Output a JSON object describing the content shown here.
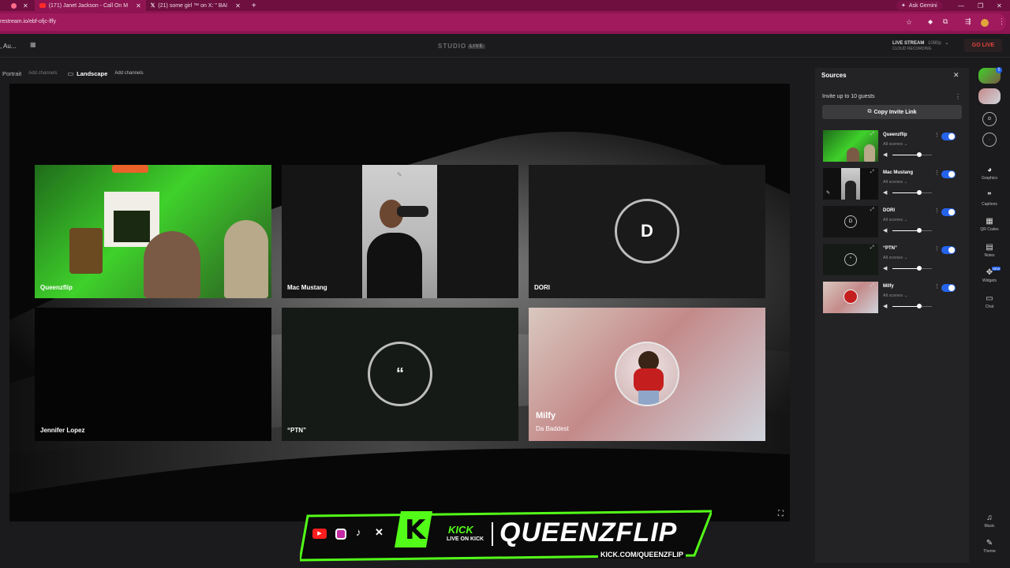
{
  "browser": {
    "tabs": [
      {
        "title": "(171) Janet Jackson - Call On M",
        "icon": "youtube-icon",
        "active": true
      },
      {
        "title": "(21) some girl ™ on X: \" BAI",
        "icon": "x-icon",
        "active": false
      }
    ],
    "new_tab": "+",
    "ask_gemini": "Ask Gemini",
    "url": "restream.io/ebf-ofjc-lffy"
  },
  "app": {
    "event_title": ", Au...",
    "studio_label": "STUDIO",
    "studio_badge": "LIVE",
    "live_stream_label": "LIVE STREAM",
    "live_stream_quality": "1080p",
    "cloud_recording": "CLOUD RECORDING",
    "go_live": "GO LIVE",
    "layout_tabs": [
      {
        "label": "Portrait",
        "add": "Add channels"
      },
      {
        "label": "Landscape",
        "add": "Add channels"
      }
    ]
  },
  "stage": {
    "tiles": [
      {
        "name": "Queenzflip",
        "kind": "video-green"
      },
      {
        "name": "Mac Mustang",
        "kind": "video-portrait"
      },
      {
        "name": "DORI",
        "kind": "avatar",
        "initial": "D"
      },
      {
        "name": "Jennifer Lopez",
        "kind": "blank"
      },
      {
        "name": "“PTN”",
        "kind": "avatar",
        "initial": "“"
      },
      {
        "name": "Milfy",
        "subtitle": "Da Baddest",
        "kind": "avatar-photo"
      }
    ]
  },
  "sources": {
    "title": "Sources",
    "invite_text": "Invite up to 10 guests",
    "copy_invite": "Copy Invite Link",
    "items": [
      {
        "name": "Queenzflip",
        "scenes": "All scenes",
        "volume": 0.75,
        "enabled": true
      },
      {
        "name": "Mac Mustang",
        "scenes": "All scenes",
        "volume": 0.75,
        "enabled": true
      },
      {
        "name": "DORI",
        "scenes": "All scenes",
        "volume": 0.75,
        "enabled": true
      },
      {
        "name": "“PTN”",
        "scenes": "All scenes",
        "volume": 0.75,
        "enabled": true
      },
      {
        "name": "Milfy",
        "scenes": "All scenes",
        "volume": 0.75,
        "enabled": true
      }
    ]
  },
  "rail": {
    "avatar_badge": "5",
    "items": [
      {
        "label": "Graphics",
        "icon": "palette-icon"
      },
      {
        "label": "Captions",
        "icon": "quote-icon"
      },
      {
        "label": "QR Codes",
        "icon": "qr-icon"
      },
      {
        "label": "Notes",
        "icon": "notes-icon"
      },
      {
        "label": "Widgets",
        "icon": "widgets-icon",
        "badge": "NEW"
      },
      {
        "label": "Chat",
        "icon": "chat-icon"
      },
      {
        "label": "Music",
        "icon": "music-icon"
      },
      {
        "label": "Theme",
        "icon": "theme-icon"
      }
    ]
  },
  "overlay": {
    "kick_word": "KICK",
    "kick_sub": "LIVE ON KICK",
    "brand": "QUEENZFLIP",
    "url": "KICK.COM/QUEENZFLIP"
  },
  "colors": {
    "accent_blue": "#2563eb",
    "go_live_red": "#e0443a",
    "kick_green": "#53fc18",
    "browser_magenta": "#8f1452"
  }
}
